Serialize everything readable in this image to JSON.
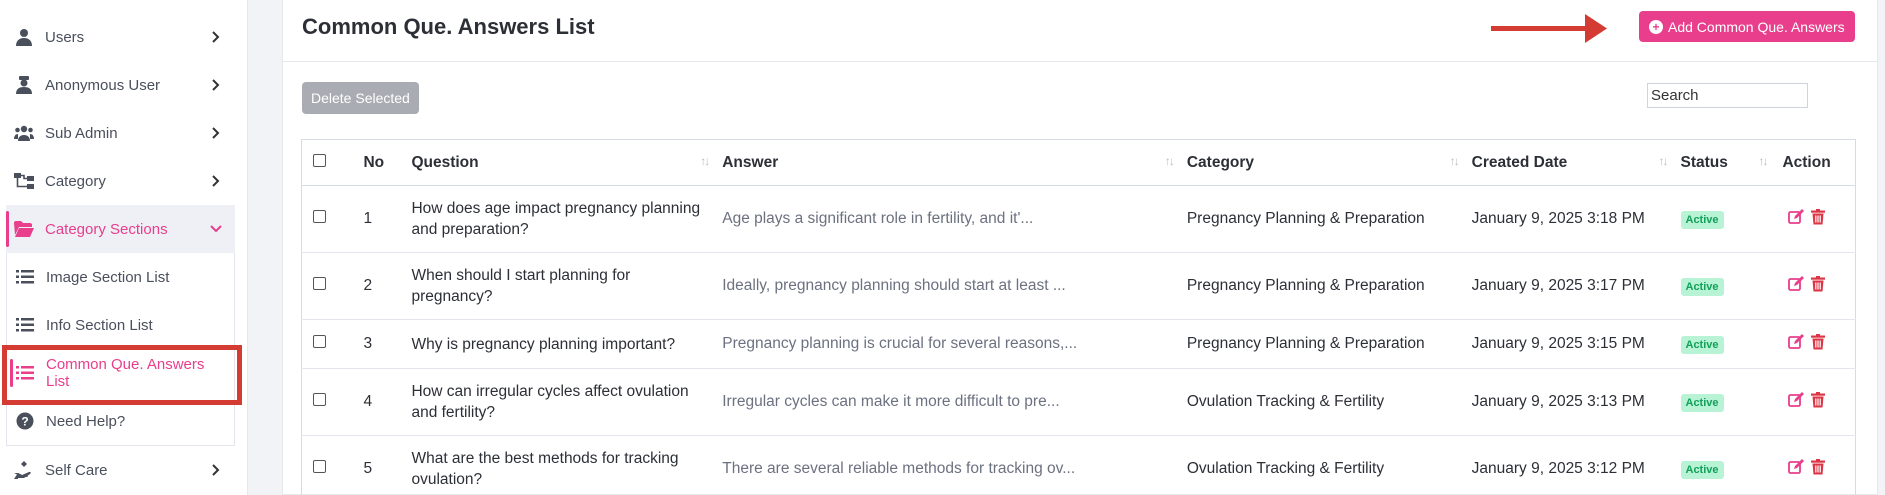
{
  "sidebar": {
    "items": [
      {
        "label": "Users",
        "icon": "user-icon"
      },
      {
        "label": "Anonymous User",
        "icon": "user-secret-icon"
      },
      {
        "label": "Sub Admin",
        "icon": "users-icon"
      },
      {
        "label": "Category",
        "icon": "sitemap-icon"
      },
      {
        "label": "Category Sections",
        "icon": "folder-open-icon"
      }
    ],
    "subitems": [
      {
        "label": "Image Section List",
        "icon": "list-icon"
      },
      {
        "label": "Info Section List",
        "icon": "list-icon"
      },
      {
        "label": "Common Que. Answers List",
        "icon": "list-icon"
      },
      {
        "label": "Need Help?",
        "icon": "question-circle-icon"
      }
    ],
    "footer_item": {
      "label": "Self Care",
      "icon": "hand-holding-icon"
    }
  },
  "header": {
    "title": "Common Que. Answers List",
    "add_button": "Add Common Que. Answers"
  },
  "toolbar": {
    "delete_selected": "Delete Selected",
    "search_placeholder": "Search"
  },
  "table": {
    "columns": [
      "No",
      "Question",
      "Answer",
      "Category",
      "Created Date",
      "Status",
      "Action"
    ],
    "rows": [
      {
        "no": "1",
        "question": "How does age impact pregnancy planning and preparation?",
        "answer": "Age plays a significant role in fertility, and it'...",
        "category": "Pregnancy Planning & Preparation",
        "created": "January 9, 2025 3:18 PM",
        "status": "Active"
      },
      {
        "no": "2",
        "question": "When should I start planning for pregnancy?",
        "answer": "Ideally, pregnancy planning should start at least ...",
        "category": "Pregnancy Planning & Preparation",
        "created": "January 9, 2025 3:17 PM",
        "status": "Active"
      },
      {
        "no": "3",
        "question": "Why is pregnancy planning important?",
        "answer": "Pregnancy planning is crucial for several reasons,...",
        "category": "Pregnancy Planning & Preparation",
        "created": "January 9, 2025 3:15 PM",
        "status": "Active"
      },
      {
        "no": "4",
        "question": "How can irregular cycles affect ovulation and fertility?",
        "answer": "Irregular cycles can make it more difficult to pre...",
        "category": "Ovulation Tracking & Fertility",
        "created": "January 9, 2025 3:13 PM",
        "status": "Active"
      },
      {
        "no": "5",
        "question": "What are the best methods for tracking ovulation?",
        "answer": "There are several reliable methods for tracking ov...",
        "category": "Ovulation Tracking & Fertility",
        "created": "January 9, 2025 3:12 PM",
        "status": "Active"
      }
    ]
  },
  "colors": {
    "accent": "#e83e8c",
    "highlight": "#d43c33",
    "active_badge_bg": "#b8f3d6",
    "active_badge_text": "#13a05a",
    "danger": "#dc3545"
  }
}
